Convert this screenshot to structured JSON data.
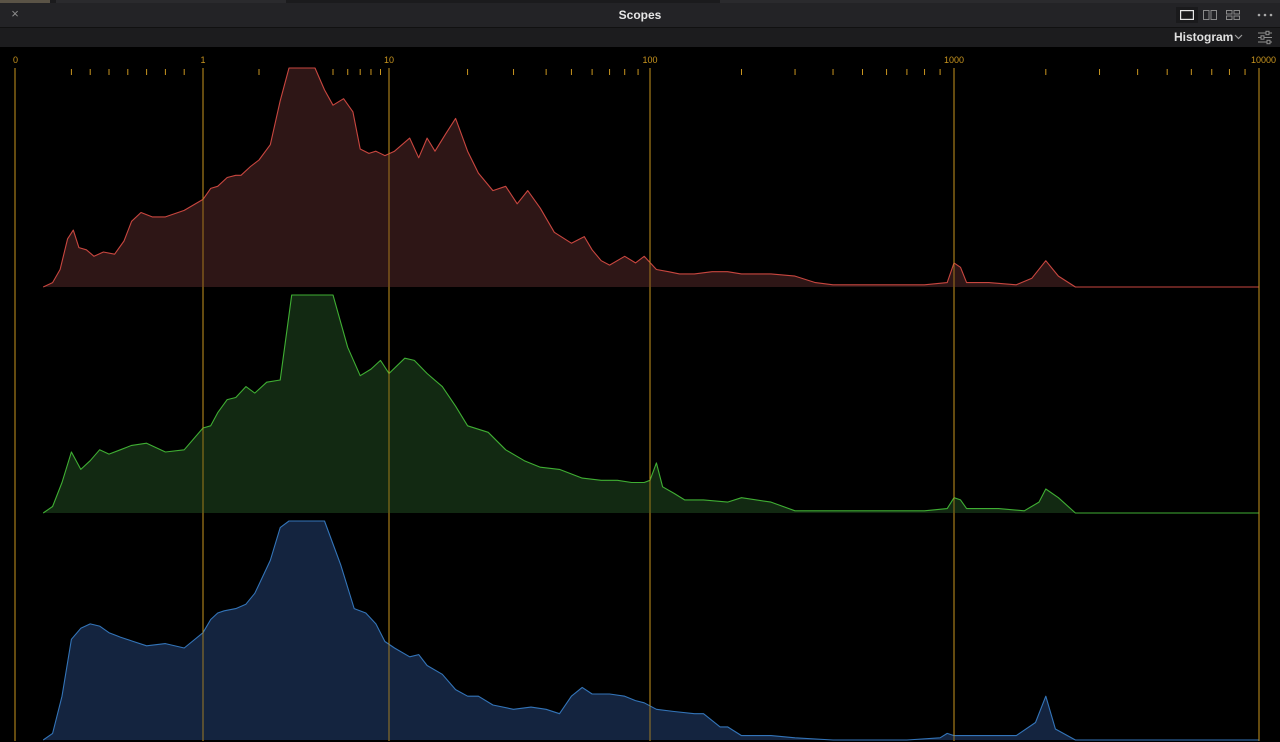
{
  "window": {
    "title": "Scopes",
    "close_glyph": "×"
  },
  "layout_buttons": [
    {
      "name": "single-view-icon",
      "active": true
    },
    {
      "name": "dual-view-icon",
      "active": false
    },
    {
      "name": "quad-view-icon",
      "active": false
    }
  ],
  "menu_glyph": "•••",
  "toolbar": {
    "mode_label": "Histogram",
    "mode_icon": "chevron-down-icon",
    "settings_icon": "sliders-icon"
  },
  "colors": {
    "guide": "#c9951f",
    "red_line": "#c8463f",
    "red_fill": "#2e1616",
    "green_line": "#3fae33",
    "green_fill": "#122912",
    "blue_line": "#3374b8",
    "blue_fill": "#14243f",
    "baseline": "#4a4a4a"
  },
  "chart_data": {
    "type": "area",
    "x_scale": "log",
    "xlim": [
      0,
      10000
    ],
    "major_ticks": [
      "0",
      "1",
      "10",
      "100",
      "1000",
      "10000"
    ],
    "series": [
      {
        "channel": "red",
        "points": [
          [
            0.15,
            0
          ],
          [
            0.2,
            2
          ],
          [
            0.24,
            8
          ],
          [
            0.28,
            22
          ],
          [
            0.31,
            26
          ],
          [
            0.34,
            18
          ],
          [
            0.38,
            17
          ],
          [
            0.42,
            14
          ],
          [
            0.47,
            16
          ],
          [
            0.53,
            15
          ],
          [
            0.58,
            21
          ],
          [
            0.62,
            30
          ],
          [
            0.67,
            34
          ],
          [
            0.73,
            32
          ],
          [
            0.8,
            32
          ],
          [
            0.9,
            35
          ],
          [
            1,
            40
          ],
          [
            1.1,
            45
          ],
          [
            1.2,
            46
          ],
          [
            1.35,
            50
          ],
          [
            1.5,
            51
          ],
          [
            1.6,
            51
          ],
          [
            1.8,
            55
          ],
          [
            2,
            58
          ],
          [
            2.3,
            65
          ],
          [
            2.6,
            85
          ],
          [
            2.9,
            100
          ],
          [
            3.5,
            100
          ],
          [
            4,
            100
          ],
          [
            4.5,
            90
          ],
          [
            5,
            83
          ],
          [
            5.7,
            86
          ],
          [
            6.4,
            80
          ],
          [
            7,
            63
          ],
          [
            7.8,
            61
          ],
          [
            8.5,
            62
          ],
          [
            9.5,
            60
          ],
          [
            10.5,
            62
          ],
          [
            12,
            68
          ],
          [
            13,
            59
          ],
          [
            14,
            68
          ],
          [
            15,
            62
          ],
          [
            16.5,
            70
          ],
          [
            18,
            77
          ],
          [
            20,
            62
          ],
          [
            22,
            52
          ],
          [
            25,
            44
          ],
          [
            28,
            46
          ],
          [
            31,
            38
          ],
          [
            34,
            44
          ],
          [
            38,
            36
          ],
          [
            43,
            25
          ],
          [
            50,
            20
          ],
          [
            56,
            23
          ],
          [
            60,
            17
          ],
          [
            65,
            12
          ],
          [
            70,
            10
          ],
          [
            80,
            14
          ],
          [
            88,
            11
          ],
          [
            95,
            14
          ],
          [
            105,
            8
          ],
          [
            115,
            7
          ],
          [
            125,
            6
          ],
          [
            140,
            6
          ],
          [
            160,
            7
          ],
          [
            180,
            7
          ],
          [
            200,
            6
          ],
          [
            250,
            6
          ],
          [
            300,
            5
          ],
          [
            350,
            2
          ],
          [
            400,
            1
          ],
          [
            600,
            1
          ],
          [
            800,
            1
          ],
          [
            950,
            2
          ],
          [
            1000,
            11
          ],
          [
            1050,
            9
          ],
          [
            1100,
            2
          ],
          [
            1300,
            2
          ],
          [
            1600,
            1
          ],
          [
            1800,
            4
          ],
          [
            2000,
            12
          ],
          [
            2200,
            5
          ],
          [
            2500,
            0
          ],
          [
            10000,
            0
          ]
        ]
      },
      {
        "channel": "green",
        "points": [
          [
            0.15,
            0
          ],
          [
            0.2,
            3
          ],
          [
            0.25,
            14
          ],
          [
            0.3,
            28
          ],
          [
            0.35,
            20
          ],
          [
            0.4,
            24
          ],
          [
            0.45,
            29
          ],
          [
            0.5,
            27
          ],
          [
            0.56,
            29
          ],
          [
            0.62,
            31
          ],
          [
            0.7,
            32
          ],
          [
            0.8,
            28
          ],
          [
            0.9,
            29
          ],
          [
            1,
            39
          ],
          [
            1.1,
            40
          ],
          [
            1.2,
            46
          ],
          [
            1.35,
            52
          ],
          [
            1.5,
            53
          ],
          [
            1.7,
            58
          ],
          [
            1.9,
            55
          ],
          [
            2.2,
            60
          ],
          [
            2.6,
            61
          ],
          [
            3,
            100
          ],
          [
            3.5,
            100
          ],
          [
            4,
            100
          ],
          [
            5,
            100
          ],
          [
            6,
            76
          ],
          [
            7,
            63
          ],
          [
            8,
            66
          ],
          [
            9,
            70
          ],
          [
            10,
            64
          ],
          [
            11.5,
            71
          ],
          [
            12.5,
            70
          ],
          [
            14,
            64
          ],
          [
            16,
            58
          ],
          [
            18,
            49
          ],
          [
            20,
            40
          ],
          [
            24,
            37
          ],
          [
            28,
            29
          ],
          [
            33,
            24
          ],
          [
            38,
            21
          ],
          [
            45,
            20
          ],
          [
            55,
            16
          ],
          [
            65,
            15
          ],
          [
            75,
            15
          ],
          [
            85,
            14
          ],
          [
            95,
            14
          ],
          [
            100,
            15
          ],
          [
            105,
            23
          ],
          [
            110,
            12
          ],
          [
            120,
            9
          ],
          [
            130,
            6
          ],
          [
            150,
            6
          ],
          [
            180,
            5
          ],
          [
            200,
            7
          ],
          [
            250,
            5
          ],
          [
            300,
            1
          ],
          [
            500,
            1
          ],
          [
            800,
            1
          ],
          [
            950,
            2
          ],
          [
            1000,
            7
          ],
          [
            1050,
            6
          ],
          [
            1100,
            2
          ],
          [
            1400,
            2
          ],
          [
            1700,
            1
          ],
          [
            1900,
            5
          ],
          [
            2000,
            11
          ],
          [
            2200,
            7
          ],
          [
            2500,
            0
          ],
          [
            10000,
            0
          ]
        ]
      },
      {
        "channel": "blue",
        "points": [
          [
            0.15,
            0
          ],
          [
            0.2,
            3
          ],
          [
            0.25,
            20
          ],
          [
            0.3,
            46
          ],
          [
            0.35,
            51
          ],
          [
            0.4,
            53
          ],
          [
            0.45,
            52
          ],
          [
            0.5,
            49
          ],
          [
            0.56,
            47
          ],
          [
            0.63,
            45
          ],
          [
            0.7,
            43
          ],
          [
            0.8,
            44
          ],
          [
            0.9,
            42
          ],
          [
            1,
            49
          ],
          [
            1.1,
            55
          ],
          [
            1.2,
            58
          ],
          [
            1.3,
            59
          ],
          [
            1.5,
            60
          ],
          [
            1.7,
            62
          ],
          [
            1.9,
            67
          ],
          [
            2,
            71
          ],
          [
            2.3,
            82
          ],
          [
            2.6,
            97
          ],
          [
            2.9,
            100
          ],
          [
            3.5,
            100
          ],
          [
            4.5,
            100
          ],
          [
            5.5,
            80
          ],
          [
            6.5,
            60
          ],
          [
            7.5,
            58
          ],
          [
            8.5,
            53
          ],
          [
            9.5,
            45
          ],
          [
            10.5,
            42
          ],
          [
            12,
            38
          ],
          [
            13,
            39
          ],
          [
            14,
            34
          ],
          [
            16,
            30
          ],
          [
            18,
            23
          ],
          [
            20,
            20
          ],
          [
            22,
            20
          ],
          [
            25,
            16
          ],
          [
            30,
            14
          ],
          [
            35,
            15
          ],
          [
            40,
            14
          ],
          [
            45,
            12
          ],
          [
            50,
            20
          ],
          [
            55,
            24
          ],
          [
            60,
            21
          ],
          [
            70,
            21
          ],
          [
            80,
            20
          ],
          [
            88,
            18
          ],
          [
            95,
            17
          ],
          [
            105,
            14
          ],
          [
            120,
            13
          ],
          [
            140,
            12
          ],
          [
            150,
            12
          ],
          [
            170,
            6
          ],
          [
            180,
            6
          ],
          [
            200,
            2
          ],
          [
            250,
            2
          ],
          [
            300,
            1
          ],
          [
            400,
            0
          ],
          [
            700,
            0
          ],
          [
            900,
            1
          ],
          [
            950,
            3
          ],
          [
            1000,
            2
          ],
          [
            1200,
            2
          ],
          [
            1600,
            2
          ],
          [
            1850,
            8
          ],
          [
            2000,
            20
          ],
          [
            2150,
            5
          ],
          [
            2500,
            0
          ],
          [
            10000,
            0
          ]
        ]
      }
    ]
  }
}
